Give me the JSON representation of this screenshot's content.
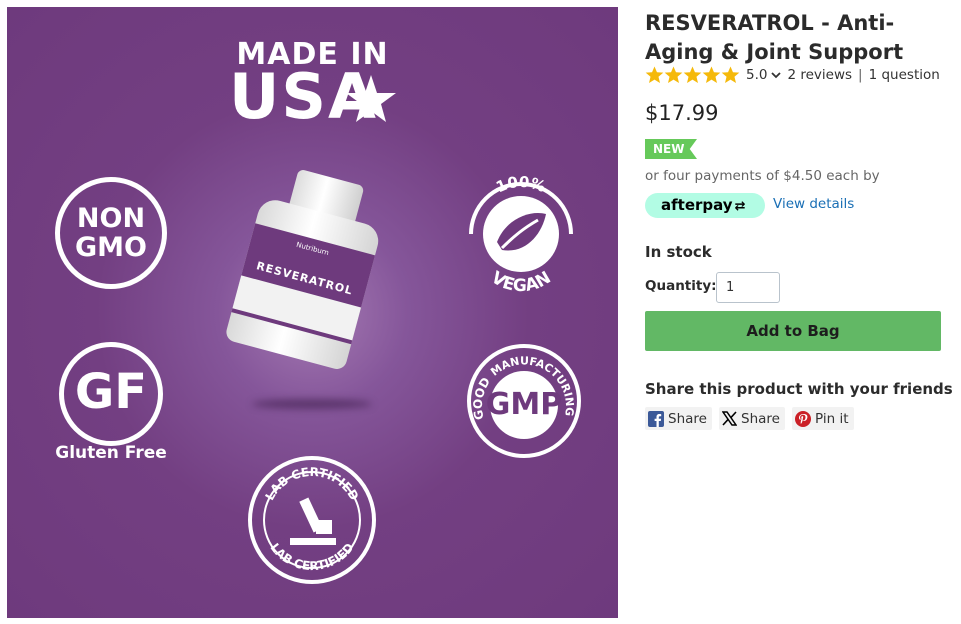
{
  "product_image": {
    "made_in_line1": "MADE IN",
    "made_in_line2": "USA",
    "badges": {
      "non_gmo_line1": "NON",
      "non_gmo_line2": "GMO",
      "gf": "GF",
      "gluten_free": "Gluten Free",
      "vegan_top": "100%",
      "vegan_bottom": "VEGAN",
      "gmp": "GMP",
      "gmp_ring_left": "GOOD",
      "gmp_ring_right": "MANUFACTURING",
      "lab_top": "LAB CERTIFIED",
      "lab_bottom": "LAB CERTIFIED"
    },
    "bottle": {
      "brand": "Nutriburn",
      "name": "RESVERATROL"
    },
    "background_color": "#6e3a7d"
  },
  "product": {
    "title": "RESVERATROL - Anti-Aging & Joint Support",
    "rating": "5.0",
    "reviews": "2 reviews",
    "separator": "|",
    "questions": "1 question",
    "price": "$17.99",
    "badge": "NEW",
    "payments_text": "or four payments of $4.50 each by",
    "afterpay_logo": "afterpay",
    "view_details": "View details",
    "stock_status": "In stock",
    "quantity_label": "Quantity:",
    "quantity_value": "1",
    "add_to_bag": "Add to Bag"
  },
  "share": {
    "title": "Share this product with your friends",
    "facebook": "Share",
    "x": "Share",
    "pinterest": "Pin it"
  },
  "colors": {
    "star": "#f5b90a",
    "new_badge": "#66c95a",
    "afterpay": "#b2fce4",
    "link": "#1a6fb5",
    "add_button": "#62b865",
    "facebook": "#3b5998",
    "pinterest": "#cb2027"
  }
}
